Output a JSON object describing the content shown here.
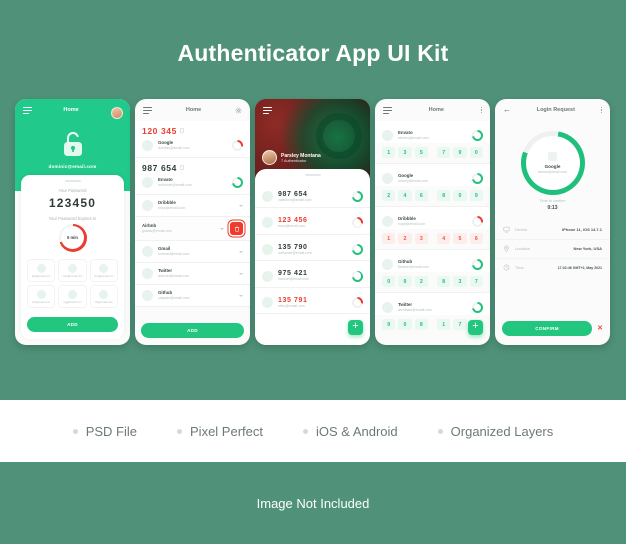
{
  "hero": {
    "title": "Authenticator App UI Kit"
  },
  "theme": {
    "background": "#4f9279",
    "accent_green": "#22c67f",
    "alert_red": "#ea3d2f",
    "panel_white": "#ffffff"
  },
  "screens": {
    "one": {
      "title": "Home",
      "menu_icon": "hamburger-icon",
      "avatar_icon": "user-avatar",
      "lock_icon": "open-lock-icon",
      "account_email": "dominic@email.com",
      "password_label": "Your Password",
      "password_code": "123450",
      "expires_label": "Your Password Expires In",
      "timer_value": "5 min",
      "accounts": [
        {
          "email": "jnk@email.com"
        },
        {
          "email": "max@email.com"
        },
        {
          "email": "sue@email.com"
        },
        {
          "email": "erl@email.com"
        },
        {
          "email": "lig@email.com"
        },
        {
          "email": "zlu@email.com"
        }
      ],
      "add_button": "ADD"
    },
    "two": {
      "title": "Home",
      "menu_icon": "hamburger-icon",
      "settings_icon": "gear-icon",
      "items": [
        {
          "code": "120 345",
          "name": "Google",
          "email": "dominic@email.com",
          "state": "expanded",
          "ring": "red",
          "color": "red"
        },
        {
          "code": "987 654",
          "name": "Envato",
          "email": "nathaniel@email.com",
          "state": "expanded",
          "ring": "green",
          "color": "dark"
        },
        {
          "code": "",
          "name": "Dribbble",
          "email": "brian@email.com",
          "state": "collapsed",
          "ring": "",
          "color": ""
        },
        {
          "code": "",
          "name": "Airbnb",
          "email": "gustav@email.com",
          "state": "selected",
          "ring": "",
          "color": ""
        },
        {
          "code": "",
          "name": "Gmail",
          "email": "norman@email.com",
          "state": "collapsed",
          "ring": "",
          "color": ""
        },
        {
          "code": "",
          "name": "Twitter",
          "email": "antonio@email.com",
          "state": "collapsed",
          "ring": "",
          "color": ""
        },
        {
          "code": "",
          "name": "Github",
          "email": "caspian@email.com",
          "state": "collapsed",
          "ring": "",
          "color": ""
        }
      ],
      "delete_icon": "trash-icon",
      "add_button": "ADD"
    },
    "three": {
      "menu_icon": "hamburger-icon",
      "user_name": "Parsley Montana",
      "user_subtitle": "7 Authenticator",
      "items": [
        {
          "code": "987 654",
          "email": "valentino@email.com",
          "ring": "green",
          "color": "dark"
        },
        {
          "code": "123 456",
          "email": "brian@email.com",
          "ring": "red",
          "color": "red"
        },
        {
          "code": "135 790",
          "email": "nathaniel@email.com",
          "ring": "green",
          "color": "dark"
        },
        {
          "code": "975 421",
          "email": "hanson@email.com",
          "ring": "green",
          "color": "dark"
        },
        {
          "code": "135 791",
          "email": "niles@email.com",
          "ring": "red",
          "color": "red"
        }
      ],
      "fab_icon": "plus-icon"
    },
    "four": {
      "title": "Home",
      "menu_icon": "hamburger-icon",
      "more_icon": "more-vertical-icon",
      "items": [
        {
          "name": "Envato",
          "email": "winters@email.com",
          "ring": "green",
          "digits": [
            "1",
            "3",
            "5",
            "7",
            "9",
            "0"
          ],
          "color": "g"
        },
        {
          "name": "Google",
          "email": "rodney@email.com",
          "ring": "green",
          "digits": [
            "2",
            "4",
            "6",
            "8",
            "0",
            "9"
          ],
          "color": "g"
        },
        {
          "name": "Dribbble",
          "email": "hugh@email.com",
          "ring": "red",
          "digits": [
            "1",
            "2",
            "3",
            "4",
            "5",
            "6"
          ],
          "color": "r"
        },
        {
          "name": "Github",
          "email": "fletcher@email.com",
          "ring": "green",
          "digits": [
            "0",
            "9",
            "2",
            "8",
            "3",
            "7"
          ],
          "color": "g"
        },
        {
          "name": "Twitter",
          "email": "archibald@email.com",
          "ring": "green",
          "digits": [
            "9",
            "0",
            "8",
            "1",
            "7",
            "2"
          ],
          "color": "g"
        }
      ],
      "fab_icon": "plus-icon"
    },
    "five": {
      "title": "Login Request",
      "back_icon": "back-arrow-icon",
      "more_icon": "more-vertical-icon",
      "service_name": "Google",
      "service_email": "francis@email.com",
      "confirm_label": "Time to confirm",
      "confirm_value": "0:13",
      "details": [
        {
          "icon": "monitor-icon",
          "key": "Device",
          "value": "iPhone 11, iOS 14.7.1"
        },
        {
          "icon": "location-icon",
          "key": "Location",
          "value": "New York, USA"
        },
        {
          "icon": "clock-icon",
          "key": "Time",
          "value": "17:32:46 GMT+2, May 2021"
        }
      ],
      "confirm_button": "CONFIRM",
      "dismiss_icon": "close-icon"
    }
  },
  "features": [
    {
      "label": "PSD File"
    },
    {
      "label": "Pixel Perfect"
    },
    {
      "label": "iOS & Android"
    },
    {
      "label": "Organized Layers"
    }
  ],
  "footer": {
    "note": "Image Not Included"
  }
}
